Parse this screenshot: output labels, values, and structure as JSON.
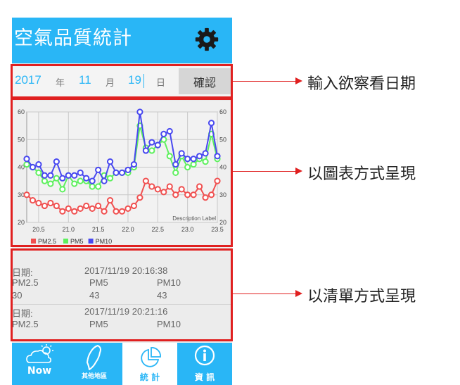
{
  "app": {
    "title": "空氣品質統計"
  },
  "date_input": {
    "year": "2017",
    "year_unit": "年",
    "month": "11",
    "month_unit": "月",
    "day": "19",
    "day_unit": "日",
    "confirm_label": "確認"
  },
  "chart_data": {
    "type": "line",
    "x": [
      20.3,
      20.4,
      20.5,
      20.6,
      20.7,
      20.8,
      20.9,
      21.0,
      21.1,
      21.2,
      21.3,
      21.4,
      21.5,
      21.6,
      21.7,
      21.8,
      21.9,
      22.0,
      22.1,
      22.2,
      22.3,
      22.4,
      22.5,
      22.6,
      22.7,
      22.8,
      22.9,
      23.0,
      23.1,
      23.2,
      23.3,
      23.4,
      23.5
    ],
    "series": [
      {
        "name": "PM2.5",
        "color": "#f05050",
        "values": [
          30,
          28,
          27,
          26,
          27,
          26,
          24,
          25,
          24,
          25,
          26,
          25,
          26,
          24,
          28,
          24,
          24,
          25,
          26,
          29,
          35,
          33,
          32,
          31,
          33,
          30,
          32,
          30,
          30,
          33,
          29,
          30,
          35
        ]
      },
      {
        "name": "PM5",
        "color": "#5ef05e",
        "values": [
          41,
          40,
          38,
          35,
          34,
          36,
          32,
          37,
          34,
          35,
          35,
          33,
          33,
          37,
          36,
          38,
          38,
          38,
          40,
          55,
          47,
          46,
          48,
          50,
          44,
          38,
          44,
          40,
          41,
          43,
          42,
          52,
          43
        ]
      },
      {
        "name": "PM10",
        "color": "#4848f0",
        "values": [
          43,
          40,
          41,
          37,
          37,
          42,
          36,
          37,
          37,
          38,
          36,
          35,
          39,
          35,
          42,
          38,
          38,
          39,
          41,
          60,
          46,
          49,
          48,
          52,
          53,
          41,
          45,
          43,
          43,
          44,
          45,
          56,
          44
        ]
      }
    ],
    "xticks": [
      "20.5",
      "21.0",
      "21.5",
      "22.0",
      "22.5",
      "23.0",
      "23.5"
    ],
    "yticks": [
      "20",
      "30",
      "40",
      "50",
      "60"
    ],
    "xlim": [
      20.3,
      23.5
    ],
    "ylim": [
      20,
      60
    ],
    "grid": true,
    "legend": "bottom-left",
    "description": "Description Label"
  },
  "list": {
    "entries": [
      {
        "date_label": "日期:",
        "datetime": "2017/11/19 20:16:38",
        "h1": "PM2.5",
        "h2": "PM5",
        "h3": "PM10",
        "v1": "30",
        "v2": "43",
        "v3": "43"
      },
      {
        "date_label": "日期:",
        "datetime": "2017/11/19 20:21:16",
        "h1": "PM2.5",
        "h2": "PM5",
        "h3": "PM10"
      }
    ]
  },
  "nav": {
    "tabs": [
      {
        "label": "Now",
        "icon": "cloud-sun-icon"
      },
      {
        "label": "其他地區",
        "icon": "taiwan-map-icon"
      },
      {
        "label": "統 計",
        "icon": "pie-chart-icon"
      },
      {
        "label": "資 訊",
        "icon": "info-icon"
      }
    ]
  },
  "annotations": {
    "date": "輸入欲察看日期",
    "chart": "以圖表方式呈現",
    "list": "以清單方式呈現"
  },
  "colors": {
    "primary": "#29b6f6",
    "highlight": "#e02020"
  }
}
